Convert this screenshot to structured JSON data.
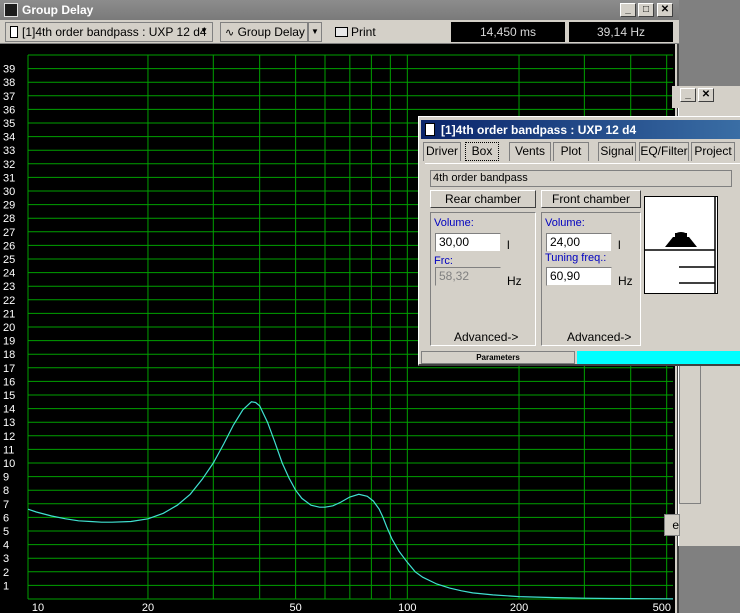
{
  "main_window": {
    "title": "Group Delay",
    "toolbar": {
      "project_selector": "[1]4th order bandpass : UXP 12 d4",
      "view_selector": "Group Delay",
      "print_label": "Print",
      "cursor_time": "14,450 ms",
      "cursor_freq": "39,14 Hz"
    }
  },
  "dialog": {
    "title": "[1]4th order bandpass : UXP 12 d4",
    "tabs": [
      "Driver",
      "Box",
      "Vents",
      "Plot",
      "Signal",
      "EQ/Filter",
      "Project"
    ],
    "active_tab": "Box",
    "box_name": "4th order bandpass",
    "rear": {
      "button": "Rear chamber",
      "volume_label": "Volume:",
      "volume_value": "30,00",
      "volume_unit": "l",
      "frc_label": "Frc:",
      "frc_value": "58,32",
      "frc_unit": "Hz",
      "advanced": "Advanced->"
    },
    "front": {
      "button": "Front chamber",
      "volume_label": "Volume:",
      "volume_value": "24,00",
      "volume_unit": "l",
      "tuning_label": "Tuning freq.:",
      "tuning_value": "60,90",
      "tuning_unit": "Hz",
      "advanced": "Advanced->"
    },
    "status_label": "Parameters"
  },
  "colors": {
    "grid": "#00a000",
    "curve": "#40e0d0",
    "plot_bg": "#000000",
    "axis_text": "#ffffff",
    "status_fill": "#00ffff"
  },
  "chart_data": {
    "type": "line",
    "title": "Group Delay",
    "xlabel": "",
    "ylabel": "",
    "x_scale": "log",
    "xlim": [
      9.5,
      520
    ],
    "ylim": [
      0,
      40
    ],
    "grid": true,
    "x_tick_labels": [
      {
        "value": 10,
        "label": "10"
      },
      {
        "value": 20,
        "label": "20"
      },
      {
        "value": 50,
        "label": "50"
      },
      {
        "value": 100,
        "label": "100"
      },
      {
        "value": 200,
        "label": "200"
      },
      {
        "value": 500,
        "label": "500"
      }
    ],
    "x_gridlines": [
      20,
      30,
      40,
      50,
      60,
      70,
      80,
      90,
      100,
      200,
      300,
      400,
      500
    ],
    "y_ticks": [
      1,
      2,
      3,
      4,
      5,
      6,
      7,
      8,
      9,
      10,
      11,
      12,
      13,
      14,
      15,
      16,
      17,
      18,
      19,
      20,
      21,
      22,
      23,
      24,
      25,
      26,
      27,
      28,
      29,
      30,
      31,
      32,
      33,
      34,
      35,
      36,
      37,
      38,
      39
    ],
    "series": [
      {
        "x": [
          9.5,
          10,
          11,
          12,
          13,
          14,
          15,
          16,
          18,
          20,
          22,
          24,
          26,
          28,
          30,
          32,
          34,
          36,
          38,
          39,
          40,
          42,
          44,
          46,
          48,
          50,
          52,
          55,
          58,
          60,
          63,
          66,
          70,
          74,
          78,
          81,
          84,
          86,
          88,
          91,
          95,
          100,
          105,
          110,
          120,
          130,
          140,
          150,
          170,
          200,
          250,
          300,
          350,
          400,
          450,
          500,
          520
        ],
        "y": [
          6.6,
          6.4,
          6.1,
          5.9,
          5.75,
          5.7,
          5.65,
          5.65,
          5.7,
          5.9,
          6.3,
          6.9,
          7.7,
          8.8,
          10.0,
          11.4,
          12.8,
          13.9,
          14.5,
          14.45,
          14.2,
          13.0,
          11.5,
          10.0,
          8.9,
          8.0,
          7.4,
          6.9,
          6.75,
          6.75,
          6.85,
          7.1,
          7.5,
          7.7,
          7.55,
          7.2,
          6.6,
          6.0,
          5.3,
          4.4,
          3.5,
          2.7,
          2.0,
          1.6,
          1.1,
          0.8,
          0.6,
          0.45,
          0.3,
          0.18,
          0.1,
          0.06,
          0.04,
          0.03,
          0.02,
          0.015,
          0.01
        ]
      }
    ]
  }
}
